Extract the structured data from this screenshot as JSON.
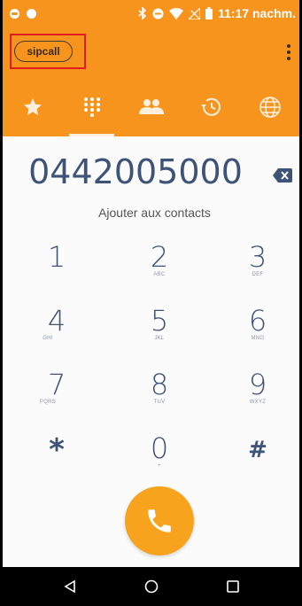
{
  "status_bar": {
    "time": "11:17 nachm.",
    "icons": [
      "notification-dot-icon",
      "minus-circle-icon",
      "bluetooth-icon",
      "do-not-disturb-icon",
      "wifi-icon",
      "no-signal-icon",
      "battery-icon"
    ]
  },
  "app_bar": {
    "account_label": "sipcall",
    "menu_icon": "overflow-menu-icon"
  },
  "tabs": [
    {
      "icon": "star-icon",
      "name": "favorites"
    },
    {
      "icon": "dialpad-icon",
      "name": "dialpad",
      "active": true
    },
    {
      "icon": "contacts-icon",
      "name": "contacts"
    },
    {
      "icon": "history-icon",
      "name": "history"
    },
    {
      "icon": "globe-icon",
      "name": "web"
    }
  ],
  "dialer": {
    "number": "0442005000",
    "add_to_contacts": "Ajouter aux contacts",
    "keys": [
      {
        "digit": "1",
        "letters": ""
      },
      {
        "digit": "2",
        "letters": "ABC"
      },
      {
        "digit": "3",
        "letters": "DEF"
      },
      {
        "digit": "4",
        "letters": "GHI"
      },
      {
        "digit": "5",
        "letters": "JKL"
      },
      {
        "digit": "6",
        "letters": "MNO"
      },
      {
        "digit": "7",
        "letters": "PQRS"
      },
      {
        "digit": "8",
        "letters": "TUV"
      },
      {
        "digit": "9",
        "letters": "WXYZ"
      },
      {
        "digit": "*",
        "letters": ""
      },
      {
        "digit": "0",
        "letters": "+"
      },
      {
        "digit": "#",
        "letters": ""
      }
    ]
  },
  "colors": {
    "accent": "#f7941d",
    "call_button": "#f7a31d",
    "digit_text": "#3e5378",
    "highlight": "#e01c1c"
  }
}
